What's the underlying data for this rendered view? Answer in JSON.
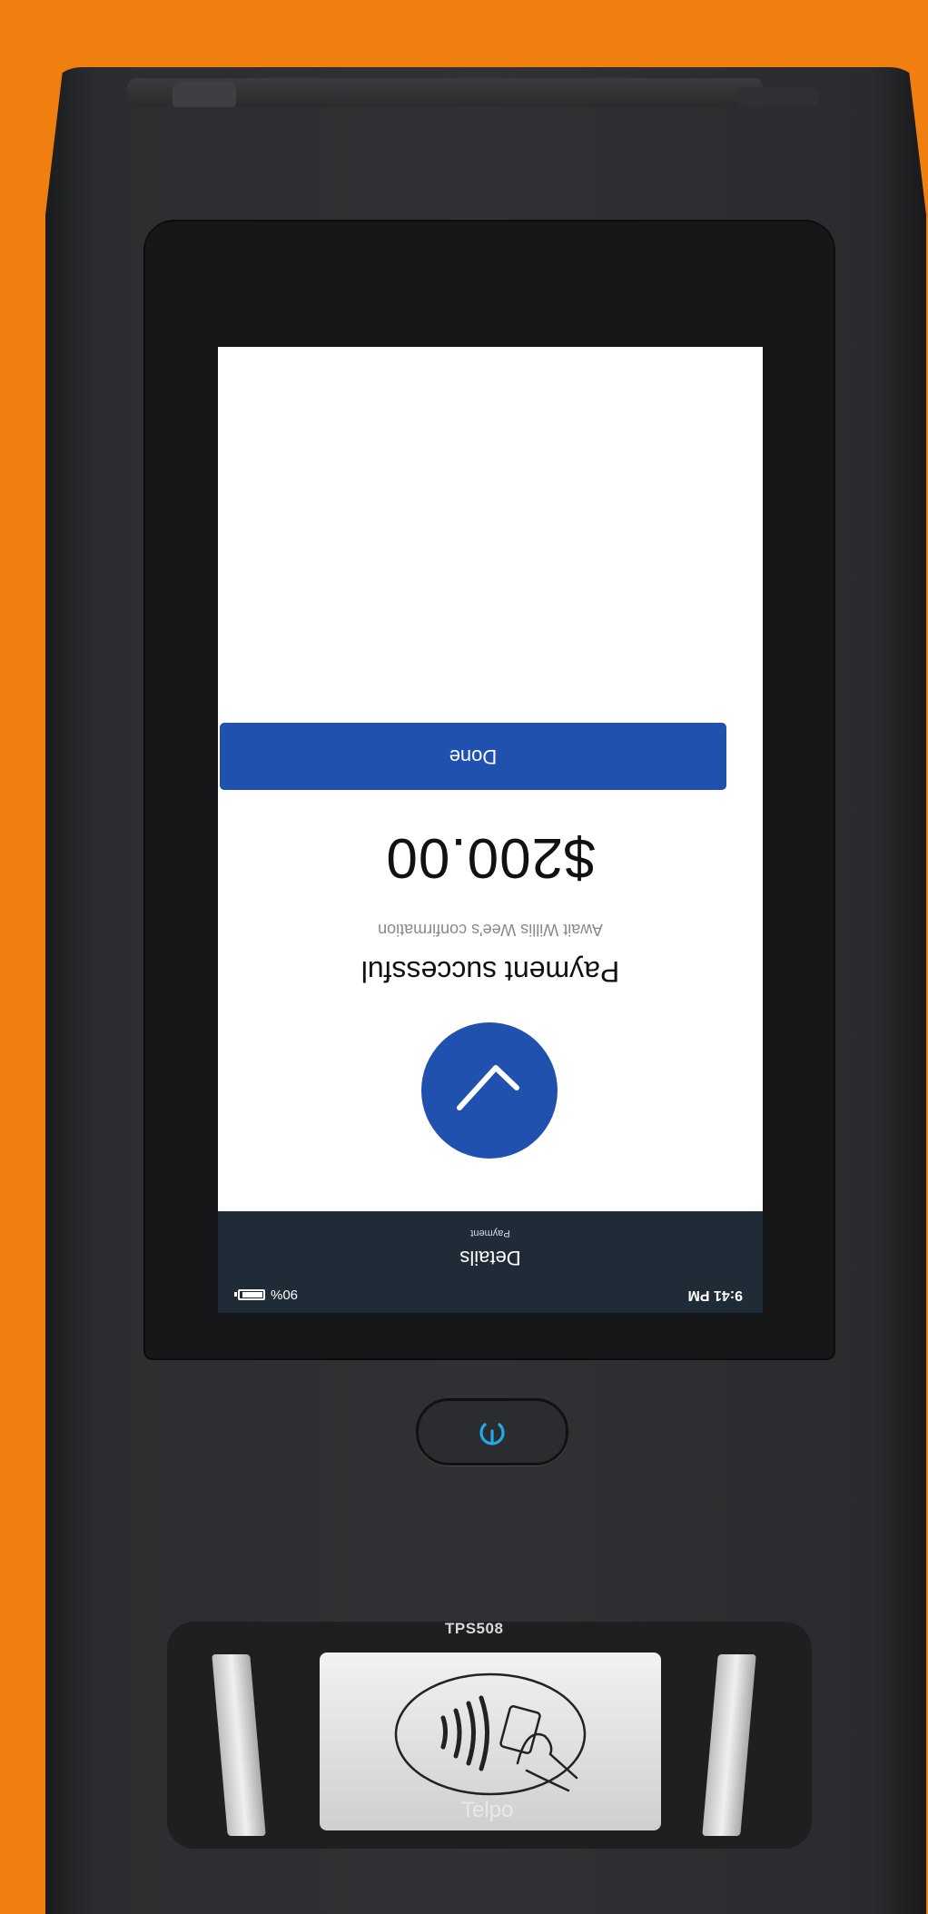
{
  "device": {
    "model": "TPS508",
    "brand": "Telpo"
  },
  "screen": {
    "status_bar": {
      "time": "9:41 PM",
      "battery": "90%",
      "battery_level": 0.9
    },
    "app_bar": {
      "title": "Details",
      "subtitle": "Payment"
    },
    "status_title": "Payment successful",
    "status_subtitle": "Await Willis Wee's confirmation",
    "amount": "$200.00",
    "done_label": "Done"
  },
  "icons": {
    "check": "check-icon",
    "power": "power-icon",
    "contactless": "contactless-icon",
    "battery": "battery-icon"
  },
  "colors": {
    "background": "#f07f0f",
    "accent": "#2151ae",
    "app_bar": "#1f2b36",
    "power_glow": "#23a8e6"
  }
}
